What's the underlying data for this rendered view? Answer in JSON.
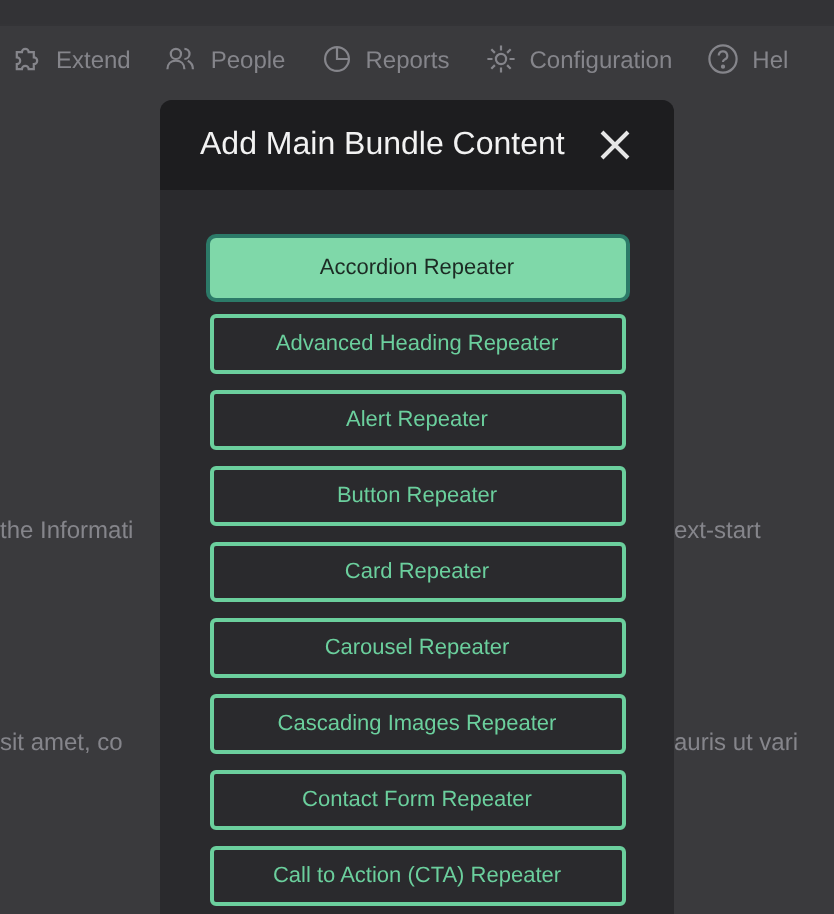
{
  "nav": [
    {
      "label": "Extend"
    },
    {
      "label": "People"
    },
    {
      "label": "Reports"
    },
    {
      "label": "Configuration"
    },
    {
      "label": "Hel"
    }
  ],
  "background_text": [
    {
      "left": "the Informati",
      "right": "ext-start"
    },
    {
      "left": "sit amet, co",
      "right": "auris ut vari"
    }
  ],
  "dialog": {
    "title": "Add Main Bundle Content",
    "items": [
      {
        "label": "Accordion Repeater",
        "selected": true
      },
      {
        "label": "Advanced Heading Repeater",
        "selected": false
      },
      {
        "label": "Alert Repeater",
        "selected": false
      },
      {
        "label": "Button Repeater",
        "selected": false
      },
      {
        "label": "Card Repeater",
        "selected": false
      },
      {
        "label": "Carousel Repeater",
        "selected": false
      },
      {
        "label": "Cascading Images Repeater",
        "selected": false
      },
      {
        "label": "Contact Form Repeater",
        "selected": false
      },
      {
        "label": "Call to Action (CTA) Repeater",
        "selected": false
      }
    ]
  }
}
